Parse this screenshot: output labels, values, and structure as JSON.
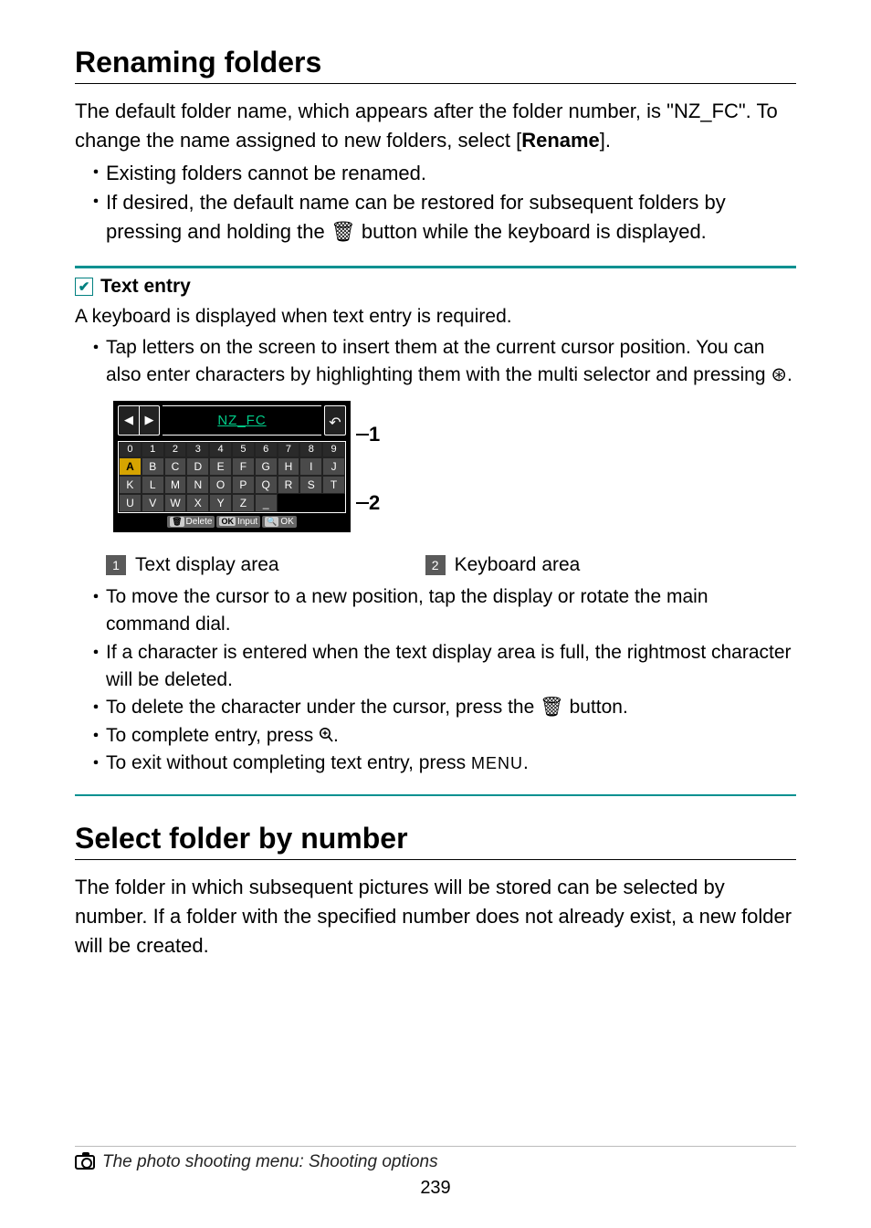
{
  "h2_rename": "Renaming folders",
  "rename_intro_a": "The default folder name, which appears after the folder number, is \"NZ_FC\". To change the name assigned to new folders, select [",
  "rename_intro_b": "Rename",
  "rename_intro_c": "].",
  "rename_bullets": [
    "Existing folders cannot be renamed.",
    "If desired, the default name can be restored for subsequent folders by pressing and holding the 🗑 button while the keyboard is displayed."
  ],
  "note_title": "Text entry",
  "note_line": "A keyboard is displayed when text entry is required.",
  "note_b1": "Tap letters on the screen to insert them at the current cursor position. You can also enter characters by highlighting them with the multi selector and pressing ⊛.",
  "sim": {
    "title": "NZ_FC",
    "row_top": [
      "0",
      "1",
      "2",
      "3",
      "4",
      "5",
      "6",
      "7",
      "8",
      "9"
    ],
    "row_a": [
      "A",
      "B",
      "C",
      "D",
      "E",
      "F",
      "G",
      "H",
      "I",
      "J"
    ],
    "row_b": [
      "K",
      "L",
      "M",
      "N",
      "O",
      "P",
      "Q",
      "R",
      "S",
      "T"
    ],
    "row_c": [
      "U",
      "V",
      "W",
      "X",
      "Y",
      "Z",
      "_",
      "",
      "",
      ""
    ],
    "soft": [
      {
        "icon": "🗑",
        "txt": "Delete"
      },
      {
        "icon": "OK",
        "txt": "Input"
      },
      {
        "icon": "🔍",
        "txt": "OK"
      }
    ]
  },
  "callouts": [
    "1",
    "2"
  ],
  "legend": [
    {
      "n": "1",
      "t": "Text display area"
    },
    {
      "n": "2",
      "t": "Keyboard area"
    }
  ],
  "note_b2": "To move the cursor to a new position, tap the display or rotate the main command dial.",
  "note_b3": "If a character is entered when the text display area is full, the rightmost character will be deleted.",
  "note_b4": "To delete the character under the cursor, press the 🗑 button.",
  "note_b5_a": "To complete entry, press ",
  "note_b5_b": ".",
  "note_b6_a": "To exit without completing text entry, press ",
  "note_b6_menu": "MENU",
  "note_b6_b": ".",
  "h2_select": "Select folder by number",
  "select_body": "The folder in which subsequent pictures will be stored can be selected by number. If a folder with the specified number does not already exist, a new folder will be created.",
  "footer_text": "The photo shooting menu: Shooting options",
  "page_num": "239"
}
